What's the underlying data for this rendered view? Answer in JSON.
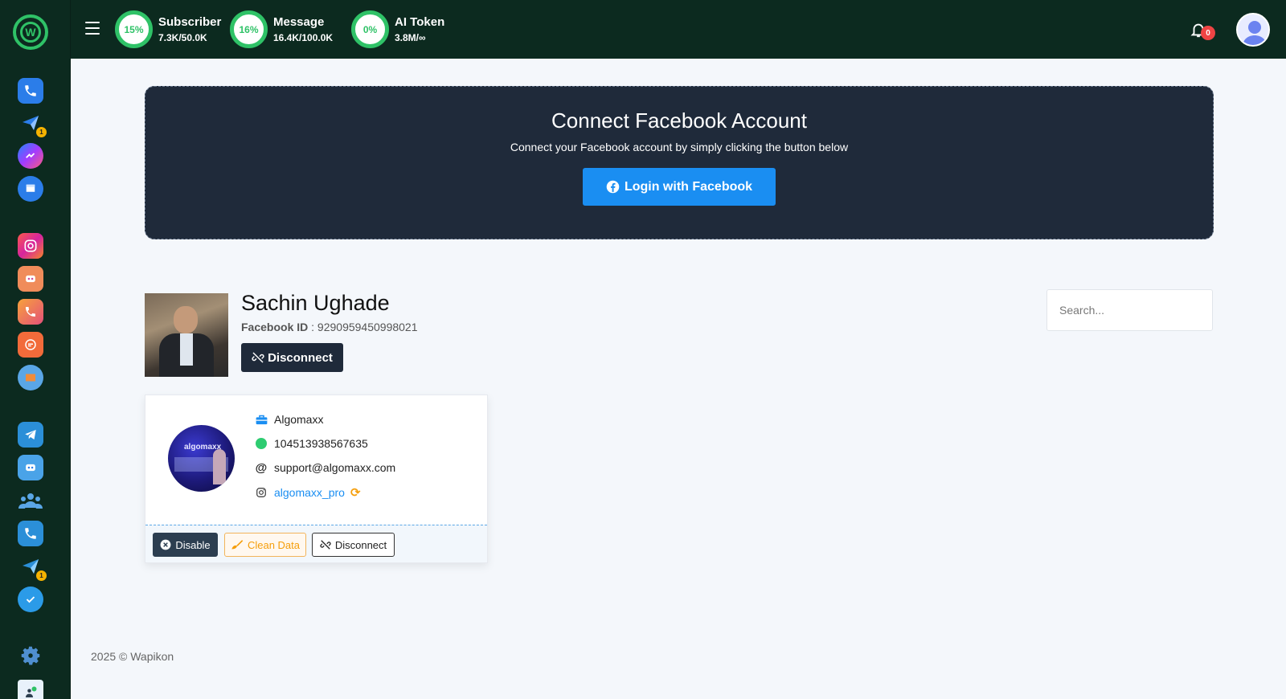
{
  "colors": {
    "accent_green": "#2fc267",
    "sidebar_bg": "#0c2a1f",
    "card_dark": "#1f2a3a",
    "facebook_blue": "#1a8ef2"
  },
  "sidebar": {
    "items": [
      {
        "icon": "wapikon-logo-icon"
      },
      {
        "icon": "whatsapp-contacts-icon"
      },
      {
        "icon": "broadcast-plane-icon",
        "badge": "1"
      },
      {
        "icon": "messenger-icon"
      },
      {
        "icon": "facebook-page-icon"
      },
      {
        "icon": "instagram-icon"
      },
      {
        "icon": "bot-icon"
      },
      {
        "icon": "phonebook-icon"
      },
      {
        "icon": "comment-icon"
      },
      {
        "icon": "sms-icon"
      },
      {
        "icon": "telegram-icon"
      },
      {
        "icon": "telegram-bot-icon"
      },
      {
        "icon": "group-icon"
      },
      {
        "icon": "telegram-contacts-icon"
      },
      {
        "icon": "telegram-broadcast-icon",
        "badge": "1"
      },
      {
        "icon": "check-circle-icon"
      },
      {
        "icon": "settings-gear-icon"
      },
      {
        "icon": "user-verified-icon"
      }
    ]
  },
  "header": {
    "stats": [
      {
        "percent": "15%",
        "title": "Subscriber",
        "value": "7.3K/50.0K",
        "fraction": 0.15
      },
      {
        "percent": "16%",
        "title": "Message",
        "value": "16.4K/100.0K",
        "fraction": 0.16
      },
      {
        "percent": "0%",
        "title": "AI Token",
        "value": "3.8M/∞",
        "fraction": 0.0
      }
    ],
    "notification_count": "0"
  },
  "connect": {
    "title": "Connect Facebook Account",
    "subtitle": "Connect your Facebook account by simply clicking the button below",
    "button_label": "Login with Facebook"
  },
  "profile": {
    "name": "Sachin Ughade",
    "id_label": "Facebook ID",
    "id_value": "9290959450998021",
    "disconnect_label": "Disconnect"
  },
  "search": {
    "placeholder": "Search..."
  },
  "page_card": {
    "avatar_text": "algomaxx",
    "name": "Algomaxx",
    "page_id": "104513938567635",
    "email": "support@algomaxx.com",
    "instagram": "algomaxx_pro",
    "buttons": {
      "disable": "Disable",
      "clean": "Clean Data",
      "disconnect": "Disconnect"
    }
  },
  "footer": {
    "text": "2025 © Wapikon"
  }
}
